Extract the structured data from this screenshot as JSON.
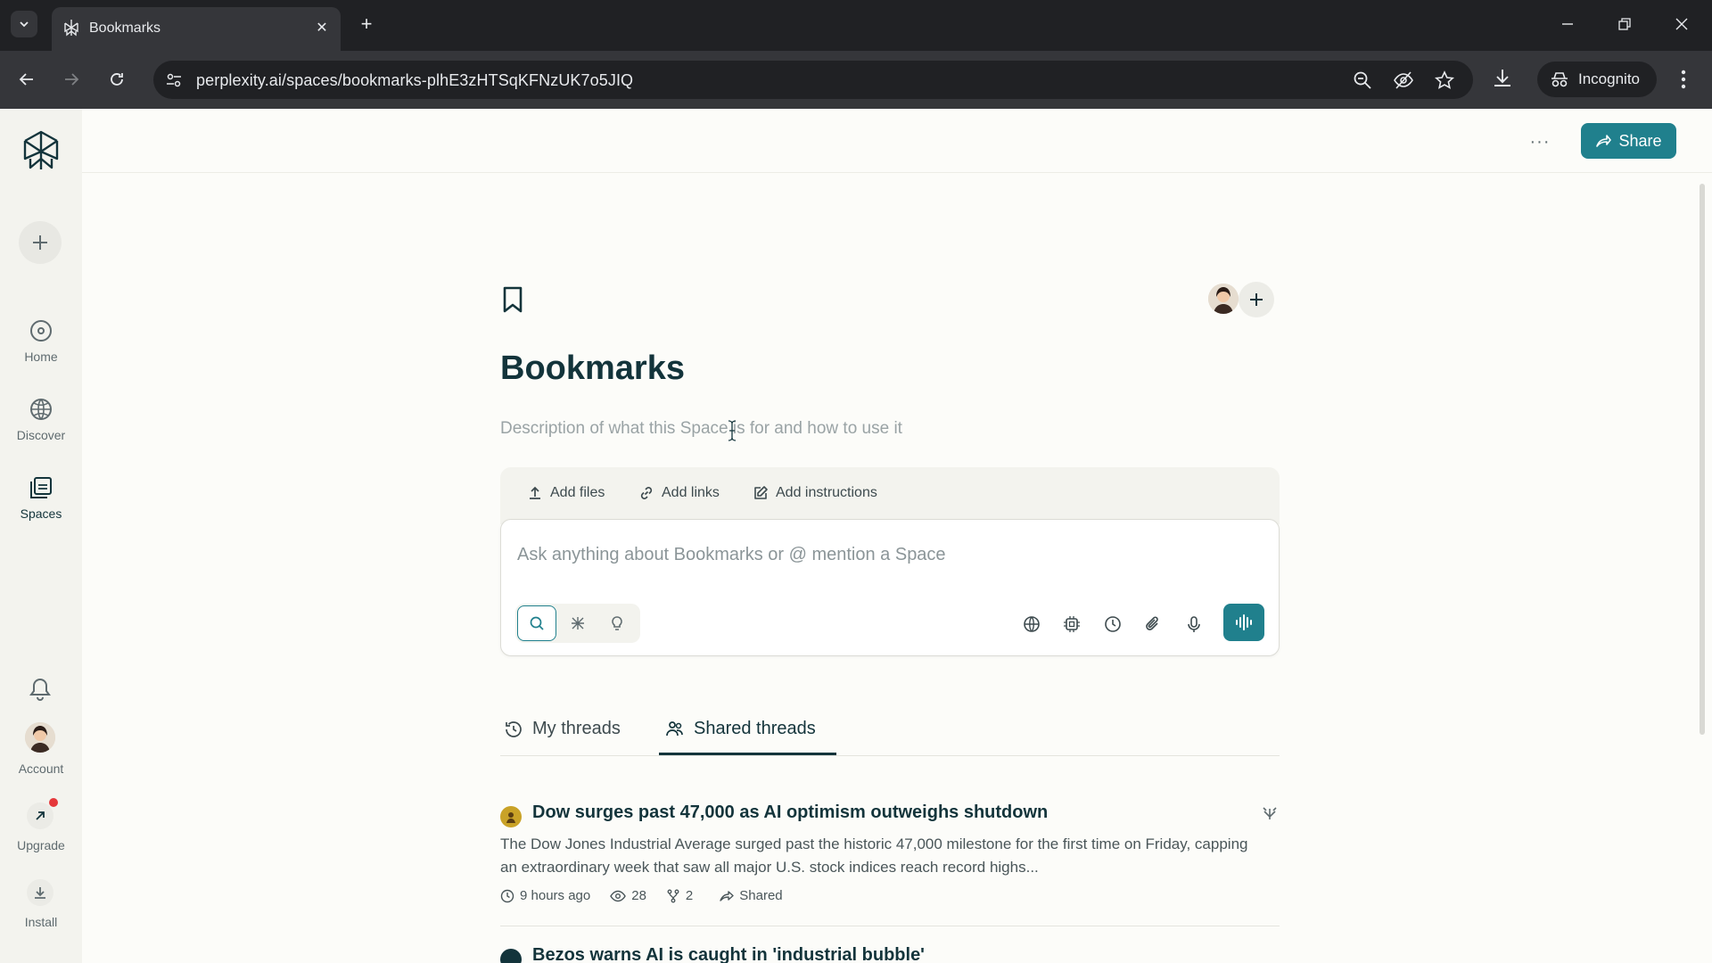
{
  "browser": {
    "tab_title": "Bookmarks",
    "url": "perplexity.ai/spaces/bookmarks-plhE3zHTSqKFNzUK7o5JIQ",
    "incognito_label": "Incognito"
  },
  "sidebar": {
    "items": [
      {
        "label": "Home"
      },
      {
        "label": "Discover"
      },
      {
        "label": "Spaces"
      }
    ],
    "account_label": "Account",
    "upgrade_label": "Upgrade",
    "install_label": "Install"
  },
  "topbar": {
    "more_label": "···",
    "share_label": "Share"
  },
  "space": {
    "title": "Bookmarks",
    "description_placeholder": "Description of what this Space is for and how to use it",
    "resources": {
      "add_files": "Add files",
      "add_links": "Add links",
      "add_instructions": "Add instructions"
    },
    "composer_placeholder": "Ask anything about Bookmarks or @ mention a Space"
  },
  "thread_tabs": {
    "my_threads": "My threads",
    "shared_threads": "Shared threads",
    "active": "Shared threads"
  },
  "threads": [
    {
      "title": "Dow surges past 47,000 as AI optimism outweighs shutdown",
      "snippet": "The Dow Jones Industrial Average surged past the historic 47,000 milestone for the first time on Friday, capping an extraordinary week that saw all major U.S. stock indices reach record highs...",
      "time": "9 hours ago",
      "views": "28",
      "forks": "2",
      "visibility": "Shared"
    },
    {
      "title": "Bezos warns AI is caught in 'industrial bubble'"
    }
  ],
  "colors": {
    "accent": "#20808d",
    "text": "#13343b",
    "background": "#fcfcf9",
    "sidebar": "#f3f3ee"
  }
}
